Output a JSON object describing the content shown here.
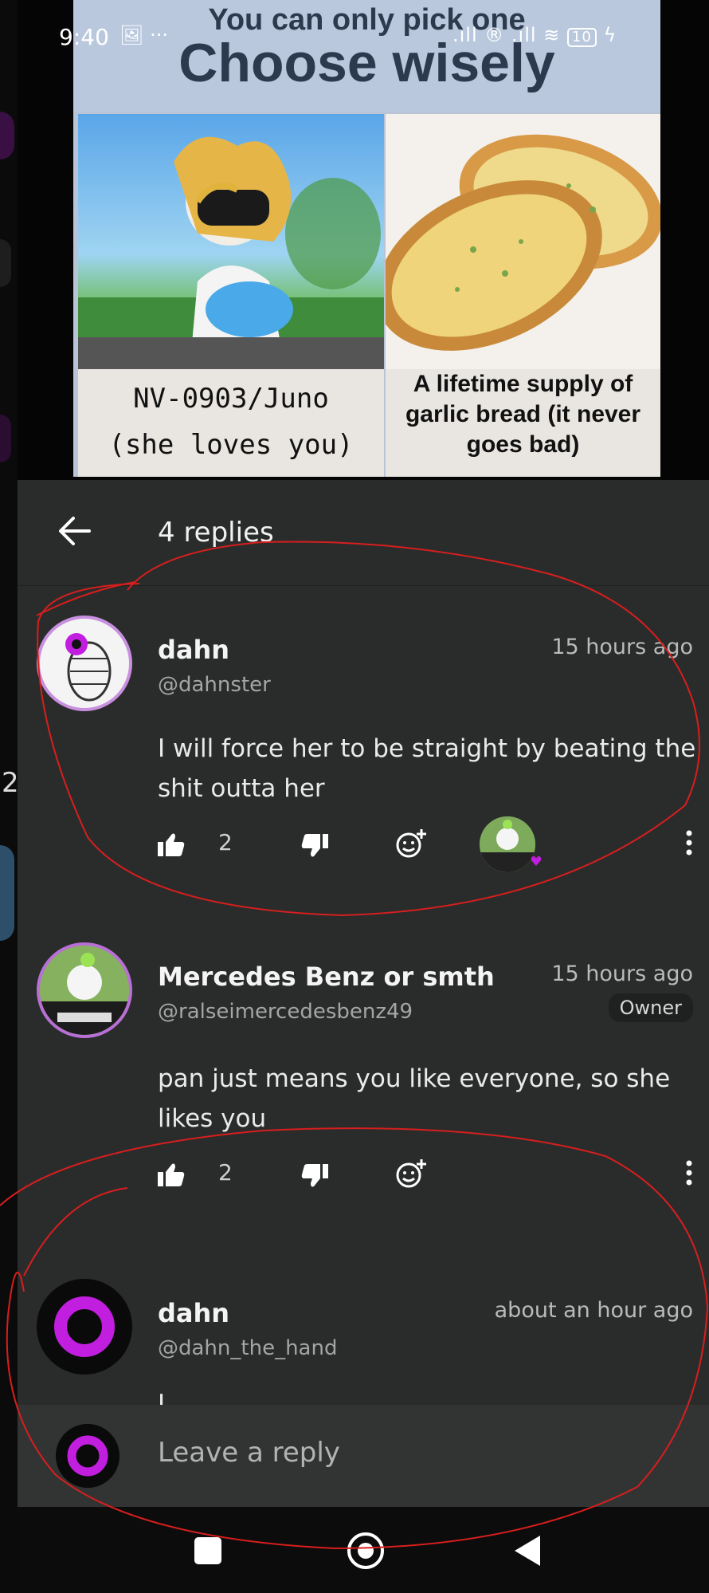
{
  "status_bar": {
    "time": "9:40",
    "left_icons": "🖼 ···",
    "right_icons": ".ıll ® .ıll",
    "battery": "10"
  },
  "meme": {
    "top_small": "You can only pick one",
    "top_big": "Choose wisely",
    "left_caption_line1": "NV-0903/Juno",
    "left_caption_line2": "(she loves you)",
    "right_caption": "A lifetime supply of garlic bread (it never goes bad)"
  },
  "replies": {
    "header_title": "4 replies",
    "comments": [
      {
        "name": "dahn",
        "handle": "@dahnster",
        "time": "15 hours ago",
        "text": "I will force her to be straight by beating the shit outta her",
        "likes": "2"
      },
      {
        "name": "Mercedes Benz or smth",
        "handle": "@ralseimercedesbenz49",
        "time": "15 hours ago",
        "badge": "Owner",
        "text": "pan just means you like everyone, so she likes you",
        "likes": "2"
      },
      {
        "name": "dahn",
        "handle": "@dahn_the_hand",
        "time": "about an hour ago",
        "text": "I"
      }
    ],
    "reply_placeholder": "Leave a reply"
  },
  "left_edge_number": "2",
  "colors": {
    "panel_bg": "#2a2c2b",
    "accent_purple": "#c21ee0",
    "annotation_red": "#d81e1e"
  }
}
